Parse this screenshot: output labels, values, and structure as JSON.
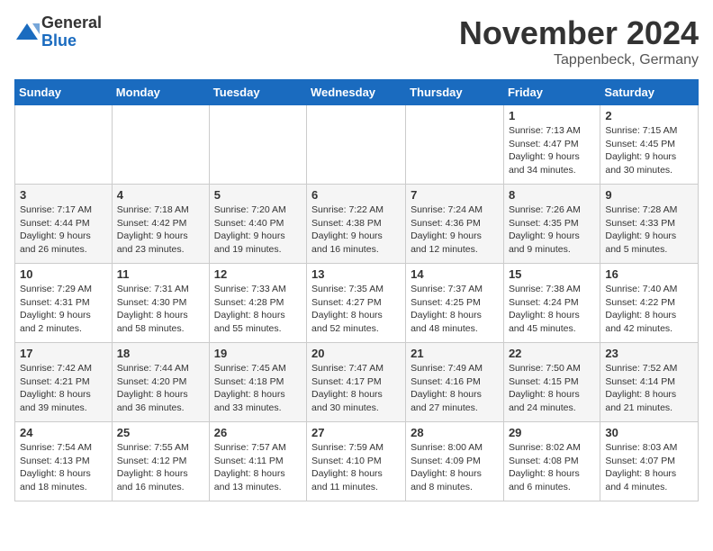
{
  "logo": {
    "general": "General",
    "blue": "Blue"
  },
  "title": "November 2024",
  "location": "Tappenbeck, Germany",
  "weekdays": [
    "Sunday",
    "Monday",
    "Tuesday",
    "Wednesday",
    "Thursday",
    "Friday",
    "Saturday"
  ],
  "weeks": [
    [
      {
        "day": "",
        "info": ""
      },
      {
        "day": "",
        "info": ""
      },
      {
        "day": "",
        "info": ""
      },
      {
        "day": "",
        "info": ""
      },
      {
        "day": "",
        "info": ""
      },
      {
        "day": "1",
        "info": "Sunrise: 7:13 AM\nSunset: 4:47 PM\nDaylight: 9 hours and 34 minutes."
      },
      {
        "day": "2",
        "info": "Sunrise: 7:15 AM\nSunset: 4:45 PM\nDaylight: 9 hours and 30 minutes."
      }
    ],
    [
      {
        "day": "3",
        "info": "Sunrise: 7:17 AM\nSunset: 4:44 PM\nDaylight: 9 hours and 26 minutes."
      },
      {
        "day": "4",
        "info": "Sunrise: 7:18 AM\nSunset: 4:42 PM\nDaylight: 9 hours and 23 minutes."
      },
      {
        "day": "5",
        "info": "Sunrise: 7:20 AM\nSunset: 4:40 PM\nDaylight: 9 hours and 19 minutes."
      },
      {
        "day": "6",
        "info": "Sunrise: 7:22 AM\nSunset: 4:38 PM\nDaylight: 9 hours and 16 minutes."
      },
      {
        "day": "7",
        "info": "Sunrise: 7:24 AM\nSunset: 4:36 PM\nDaylight: 9 hours and 12 minutes."
      },
      {
        "day": "8",
        "info": "Sunrise: 7:26 AM\nSunset: 4:35 PM\nDaylight: 9 hours and 9 minutes."
      },
      {
        "day": "9",
        "info": "Sunrise: 7:28 AM\nSunset: 4:33 PM\nDaylight: 9 hours and 5 minutes."
      }
    ],
    [
      {
        "day": "10",
        "info": "Sunrise: 7:29 AM\nSunset: 4:31 PM\nDaylight: 9 hours and 2 minutes."
      },
      {
        "day": "11",
        "info": "Sunrise: 7:31 AM\nSunset: 4:30 PM\nDaylight: 8 hours and 58 minutes."
      },
      {
        "day": "12",
        "info": "Sunrise: 7:33 AM\nSunset: 4:28 PM\nDaylight: 8 hours and 55 minutes."
      },
      {
        "day": "13",
        "info": "Sunrise: 7:35 AM\nSunset: 4:27 PM\nDaylight: 8 hours and 52 minutes."
      },
      {
        "day": "14",
        "info": "Sunrise: 7:37 AM\nSunset: 4:25 PM\nDaylight: 8 hours and 48 minutes."
      },
      {
        "day": "15",
        "info": "Sunrise: 7:38 AM\nSunset: 4:24 PM\nDaylight: 8 hours and 45 minutes."
      },
      {
        "day": "16",
        "info": "Sunrise: 7:40 AM\nSunset: 4:22 PM\nDaylight: 8 hours and 42 minutes."
      }
    ],
    [
      {
        "day": "17",
        "info": "Sunrise: 7:42 AM\nSunset: 4:21 PM\nDaylight: 8 hours and 39 minutes."
      },
      {
        "day": "18",
        "info": "Sunrise: 7:44 AM\nSunset: 4:20 PM\nDaylight: 8 hours and 36 minutes."
      },
      {
        "day": "19",
        "info": "Sunrise: 7:45 AM\nSunset: 4:18 PM\nDaylight: 8 hours and 33 minutes."
      },
      {
        "day": "20",
        "info": "Sunrise: 7:47 AM\nSunset: 4:17 PM\nDaylight: 8 hours and 30 minutes."
      },
      {
        "day": "21",
        "info": "Sunrise: 7:49 AM\nSunset: 4:16 PM\nDaylight: 8 hours and 27 minutes."
      },
      {
        "day": "22",
        "info": "Sunrise: 7:50 AM\nSunset: 4:15 PM\nDaylight: 8 hours and 24 minutes."
      },
      {
        "day": "23",
        "info": "Sunrise: 7:52 AM\nSunset: 4:14 PM\nDaylight: 8 hours and 21 minutes."
      }
    ],
    [
      {
        "day": "24",
        "info": "Sunrise: 7:54 AM\nSunset: 4:13 PM\nDaylight: 8 hours and 18 minutes."
      },
      {
        "day": "25",
        "info": "Sunrise: 7:55 AM\nSunset: 4:12 PM\nDaylight: 8 hours and 16 minutes."
      },
      {
        "day": "26",
        "info": "Sunrise: 7:57 AM\nSunset: 4:11 PM\nDaylight: 8 hours and 13 minutes."
      },
      {
        "day": "27",
        "info": "Sunrise: 7:59 AM\nSunset: 4:10 PM\nDaylight: 8 hours and 11 minutes."
      },
      {
        "day": "28",
        "info": "Sunrise: 8:00 AM\nSunset: 4:09 PM\nDaylight: 8 hours and 8 minutes."
      },
      {
        "day": "29",
        "info": "Sunrise: 8:02 AM\nSunset: 4:08 PM\nDaylight: 8 hours and 6 minutes."
      },
      {
        "day": "30",
        "info": "Sunrise: 8:03 AM\nSunset: 4:07 PM\nDaylight: 8 hours and 4 minutes."
      }
    ]
  ]
}
